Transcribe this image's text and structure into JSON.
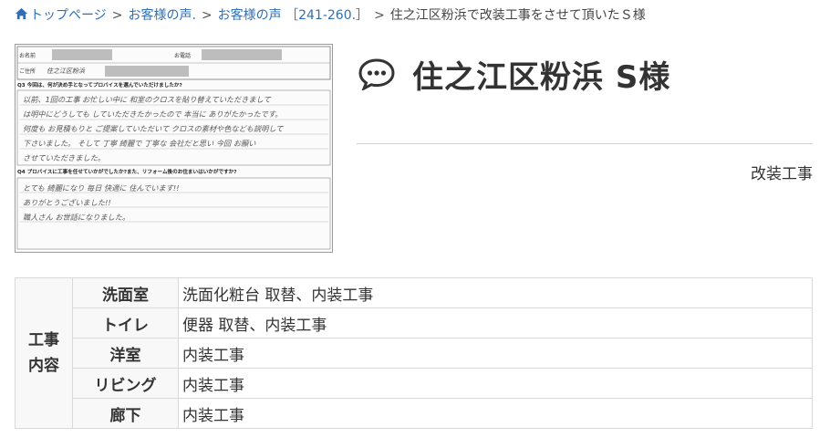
{
  "breadcrumb": {
    "home": "トップページ",
    "sep": ">",
    "level1": "お客様の声.",
    "level2": "お客様の声 ［241-260.］",
    "current": "住之江区粉浜で改装工事をさせて頂いたＳ様"
  },
  "survey": {
    "name_label": "お名前",
    "phone_label": "お電話",
    "address_label": "ご住所",
    "address_value": "住之江区粉浜",
    "q3": "Q3 今回は、何が決め手となってプロバイスを選んでいただけましたか?",
    "a3": [
      "以前、1回の工事 お忙しい中に 和室のクロスを貼り替えていただきまして",
      "は明中にどうしても していただきたかったので 本当に ありがたかったです。",
      "何度も お見積もりと ご提案していただいて クロスの素材や色なども説明して",
      "下さいました。 そして 丁寧 綺麗で 丁寧な 会社だと思い 今回 お願い",
      "させていただきました。"
    ],
    "q4": "Q4 プロバイスに工事を任せていかがでしたか?また、リフォーム後のお住まいはいかがですか?",
    "a4": [
      "とても 綺麗になり 毎日 快適に 住んでいます!!",
      "ありがとうございました!!",
      "職人さん お世話になりました。"
    ]
  },
  "title": "住之江区粉浜 S様",
  "category": "改装工事",
  "table": {
    "group_label_1": "工事",
    "group_label_2": "内容",
    "rows": [
      {
        "room": "洗面室",
        "content": "洗面化粧台 取替、内装工事"
      },
      {
        "room": "トイレ",
        "content": "便器 取替、内装工事"
      },
      {
        "room": "洋室",
        "content": "内装工事"
      },
      {
        "room": "リビング",
        "content": "内装工事"
      },
      {
        "room": "廊下",
        "content": "内装工事"
      }
    ]
  },
  "colors": {
    "link": "#2f6fb6",
    "text": "#333333",
    "border": "#d9d9d9"
  },
  "icons": {
    "home": "home-icon",
    "title": "speech-bubble-icon"
  }
}
